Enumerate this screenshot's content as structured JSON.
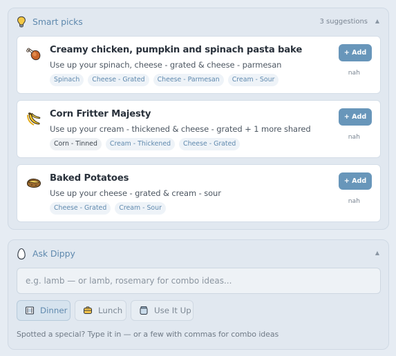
{
  "smart_picks": {
    "title": "Smart picks",
    "count_label": "3 suggestions",
    "icon": "lightbulb-icon",
    "collapse_glyph": "▲",
    "suggestions": [
      {
        "title": "Creamy chicken, pumpkin and spinach pasta bake",
        "description": "Use up your spinach, cheese - grated & cheese - parmesan",
        "icon": "drumstick-icon",
        "tags": [
          "Spinach",
          "Cheese - Grated",
          "Cheese - Parmesan",
          "Cream - Sour"
        ],
        "add_label": "+ Add",
        "dismiss_label": "nah"
      },
      {
        "title": "Corn Fritter Majesty",
        "description": "Use up your cream - thickened & cheese - grated + 1 more shared",
        "icon": "banana-icon",
        "tags": [
          "Corn - Tinned",
          "Cream - Thickened",
          "Cheese - Grated"
        ],
        "add_label": "+ Add",
        "dismiss_label": "nah"
      },
      {
        "title": "Baked Potatoes",
        "description": "Use up your cheese - grated & cream - sour",
        "icon": "potato-icon",
        "tags": [
          "Cheese - Grated",
          "Cream - Sour"
        ],
        "add_label": "+ Add",
        "dismiss_label": "nah"
      }
    ]
  },
  "ask_dippy": {
    "title": "Ask Dippy",
    "icon": "egg-icon",
    "collapse_glyph": "▲",
    "search_placeholder": "e.g. lamb — or lamb, rosemary for combo ideas...",
    "search_value": "",
    "quick_buttons": [
      {
        "label": "Dinner",
        "icon": "dinner-icon",
        "active": true
      },
      {
        "label": "Lunch",
        "icon": "lunch-box-icon",
        "active": false
      },
      {
        "label": "Use It Up",
        "icon": "jar-icon",
        "active": false
      }
    ],
    "hint": "Spotted a special? Type it in — or a few with commas for combo ideas"
  },
  "colors": {
    "accent": "#5f89ae",
    "button": "#6896ba",
    "panel_bg": "#e1e8f0",
    "card_bg": "#ffffff"
  }
}
